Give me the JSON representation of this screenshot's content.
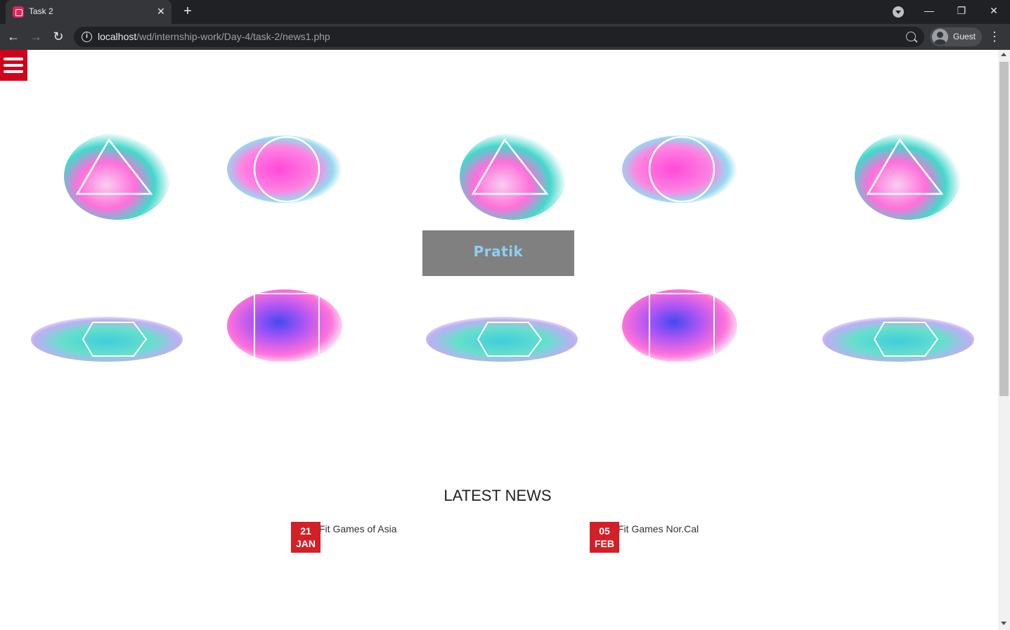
{
  "browser": {
    "tab_title": "Task 2",
    "tab_close": "✕",
    "new_tab": "+",
    "url_host": "localhost",
    "url_path": "/wd/internship-work/Day-4/task-2/news1.php",
    "profile_label": "Guest",
    "back": "←",
    "forward": "→",
    "reload": "↻",
    "menu": "⋮",
    "minimize": "—",
    "restore": "❐",
    "close": "✕"
  },
  "page": {
    "menu_icon": "hamburger-icon",
    "brand_label": "Pratik",
    "news_heading": "LATEST NEWS",
    "news": [
      {
        "text": "ssFit Games of Asia",
        "day": "21",
        "month": "JAN"
      },
      {
        "text": "ssFit Games Nor.Cal",
        "day": "05",
        "month": "FEB"
      }
    ]
  },
  "colors": {
    "accent_red": "#d32027",
    "box_gray": "#808080",
    "brand_text": "#8ecff0"
  }
}
